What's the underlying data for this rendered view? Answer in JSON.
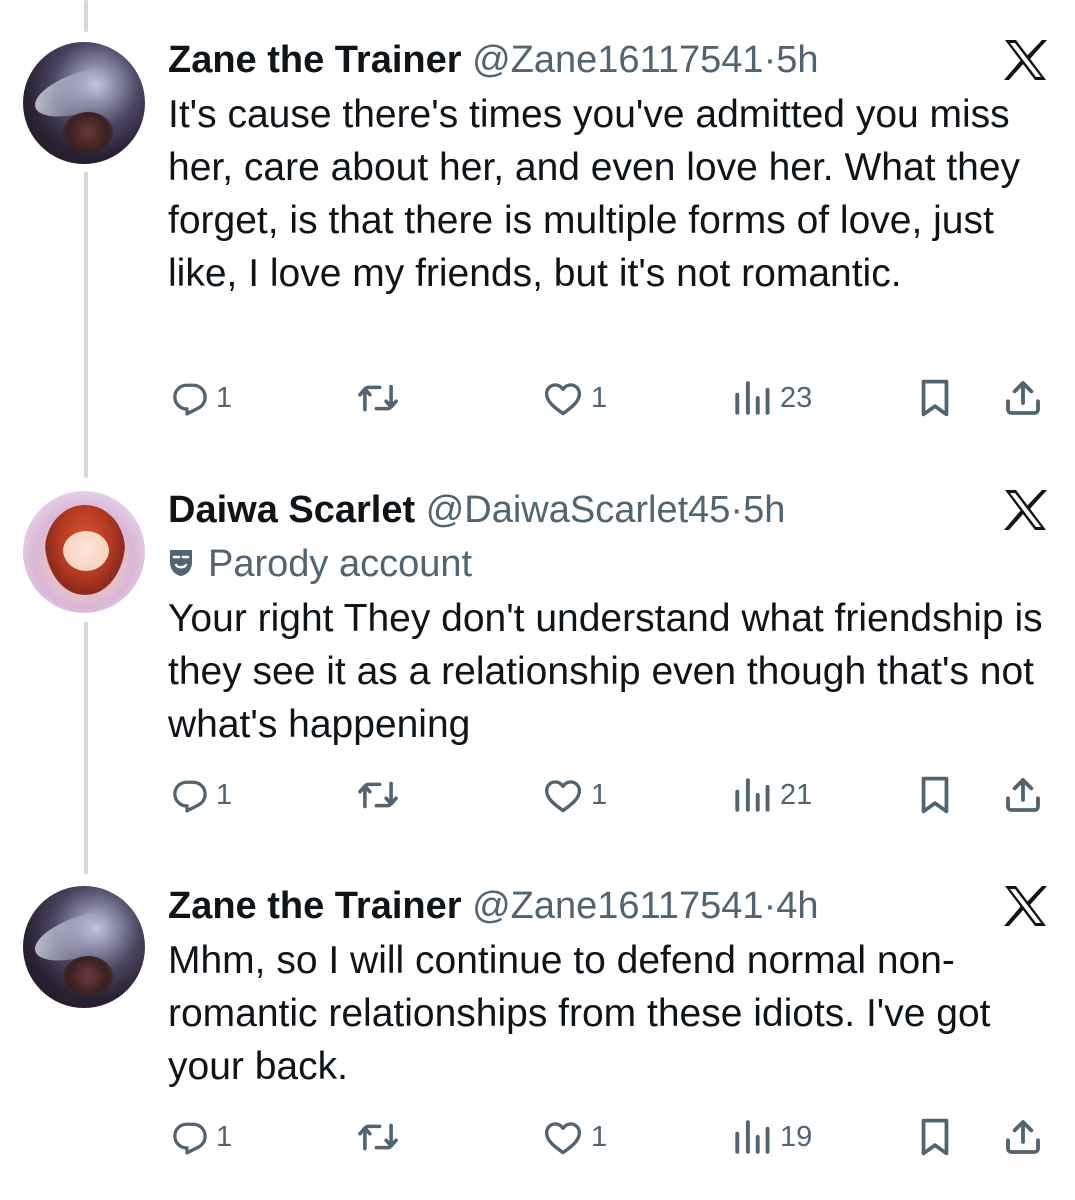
{
  "tweets": [
    {
      "name": "Zane the Trainer",
      "handle": "@Zane16117541",
      "separator": "·",
      "time": "5h",
      "parody_label": null,
      "text": "It's cause there's times you've admitted you miss her, care about her, and even love her. What they forget, is that there is multiple forms of love, just like, I love my friends, but it's not romantic.",
      "replies": "1",
      "reposts": "",
      "likes": "1",
      "views": "23",
      "avatar_icon": "avatar-dark-character"
    },
    {
      "name": "Daiwa Scarlet",
      "handle": "@DaiwaScarlet45",
      "separator": "·",
      "time": "5h",
      "parody_label": "Parody account",
      "text": "Your right They don't understand what friendship is they see it as a relationship even though that's not what's happening",
      "replies": "1",
      "reposts": "",
      "likes": "1",
      "views": "21",
      "avatar_icon": "avatar-red-hair-character"
    },
    {
      "name": "Zane the Trainer",
      "handle": "@Zane16117541",
      "separator": "·",
      "time": "4h",
      "parody_label": null,
      "text": "Mhm, so I will continue to defend normal non-romantic relationships from these idiots. I've got your back.",
      "replies": "1",
      "reposts": "",
      "likes": "1",
      "views": "19",
      "avatar_icon": "avatar-dark-character"
    }
  ],
  "icons": {
    "reply": "reply-icon",
    "repost": "repost-icon",
    "like": "like-icon",
    "views": "views-icon",
    "bookmark": "bookmark-icon",
    "share": "share-icon",
    "x_logo": "x-logo-icon",
    "parody": "mask-icon"
  },
  "colors": {
    "text": "#0f1419",
    "secondary": "#536471",
    "thread_line": "#cfd9de"
  }
}
